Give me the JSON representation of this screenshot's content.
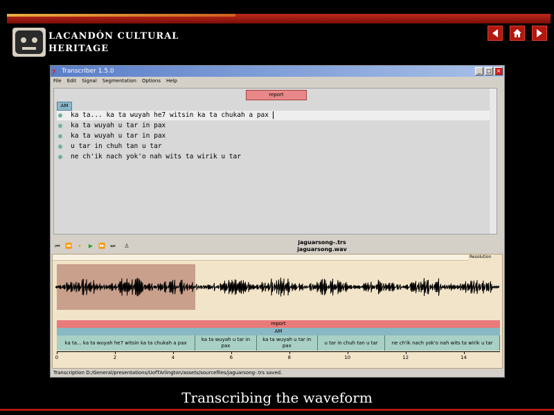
{
  "site": {
    "brand_line1": "LACANDÓN CULTURAL",
    "brand_line2": "HERITAGE"
  },
  "nav": {
    "prev_icon": "left-arrow-icon",
    "home_icon": "home-icon",
    "next_icon": "right-arrow-icon"
  },
  "window": {
    "title": "Transcriber 1.5.0",
    "menu": [
      "File",
      "Edit",
      "Signal",
      "Segmentation",
      "Options",
      "Help"
    ]
  },
  "editor": {
    "section_label": "report",
    "speaker_label": "AM",
    "lines": [
      "ka ta... ka ta wuyah he7 witsin ka ta chukah a pax",
      "ka ta wuyah u tar in pax",
      "ka ta wuyah u tar in pax",
      "u tar in chuh tan u tar",
      "ne ch'ik nach yok'o nah wits ta wirik u tar"
    ]
  },
  "player": {
    "trs_file": "jaguarsong-.trs",
    "wav_file": "jaguarsong.wav"
  },
  "signal": {
    "resolution_label": "Resolution",
    "section_label": "report",
    "speaker_label": "AM",
    "segments": [
      {
        "text": "ka ta... ka ta wuyah he7 witsin ka ta chukah a pax",
        "start": 0,
        "end": 4.77
      },
      {
        "text": "ka ta wuyah u tar in pax",
        "start": 4.77,
        "end": 6.88
      },
      {
        "text": "ka ta wuyah u tar in pax",
        "start": 6.88,
        "end": 8.98
      },
      {
        "text": "u tar in chuh tan u tar",
        "start": 8.98,
        "end": 11.3
      },
      {
        "text": "ne ch'ik nach yok'o nah wits ta wirik u tar",
        "start": 11.3,
        "end": 15.25
      }
    ],
    "axis_ticks": [
      "0",
      "2",
      "4",
      "6",
      "8",
      "10",
      "12",
      "14"
    ]
  },
  "status": "Transcription D:/General/presentations/UofTArlington/assets/sourcefiles/jaguarsong-.trs saved.",
  "caption": "Transcribing the waveform",
  "colors": {
    "accent": "#b01810",
    "segment_bg": "#a8d0c4",
    "report_bg": "#e87a7a",
    "speaker_bg": "#88b8c4"
  }
}
